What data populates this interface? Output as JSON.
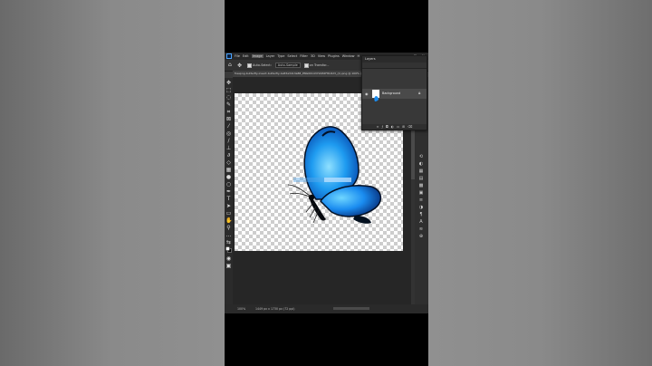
{
  "menubar": {
    "items": [
      "File",
      "Edit",
      "Image",
      "Layer",
      "Type",
      "Select",
      "Filter",
      "3D",
      "View",
      "Plugins",
      "Window",
      "H"
    ],
    "active": "Image",
    "window_controls": "– ▢ ✕"
  },
  "options_bar": {
    "auto_select_label": "Auto-Select:",
    "auto_select_value": "Auto-Sample",
    "transform_label": "on Transfor..."
  },
  "document_tab": {
    "title": "freepng-butterfly-insect-butterfly-1a83a3413a88_PNG0014372482F81D23_(1).png @ 100% (Background..."
  },
  "layers_panel": {
    "title": "Layers",
    "layer_name": "Background",
    "footer_icons": [
      "link-icon",
      "fx-icon",
      "mask-icon",
      "adjust-icon",
      "folder-icon",
      "new-layer-icon",
      "trash-icon"
    ]
  },
  "status_bar": {
    "zoom": "100%",
    "dims": "1449 px x 1730 px (72 ppi)"
  },
  "colors": {
    "accent": "#2c8bd8",
    "butterfly_blue": "#1a8cf0",
    "panel_bg": "#383838"
  }
}
